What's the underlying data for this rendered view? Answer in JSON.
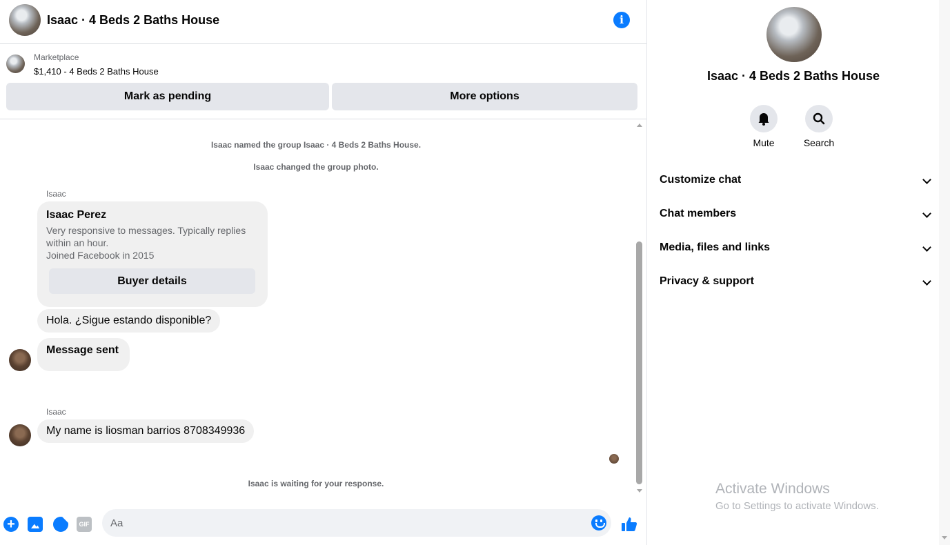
{
  "header": {
    "title": "Isaac · 4 Beds 2 Baths House"
  },
  "marketplace": {
    "label": "Marketplace",
    "item": "$1,410 - 4 Beds 2 Baths House",
    "mark_pending": "Mark as pending",
    "more_options": "More options"
  },
  "messages": {
    "sys_named": "Isaac named the group Isaac · 4 Beds 2 Baths House.",
    "sys_photo": "Isaac changed the group photo.",
    "sender1": "Isaac",
    "card": {
      "name": "Isaac Perez",
      "line1": "Very responsive to messages. Typically replies",
      "line2": "within an hour.",
      "line3": "Joined Facebook in 2015",
      "button": "Buyer details"
    },
    "msg1": "Hola. ¿Sigue estando disponible?",
    "msg2": "Message sent",
    "sender2": "Isaac",
    "msg3": "My name is liosman barrios 8708349936",
    "waiting": "Isaac is waiting for your response."
  },
  "composer": {
    "placeholder": "Aa",
    "gif": "GIF"
  },
  "info_panel": {
    "title": "Isaac · 4 Beds 2 Baths House",
    "mute": "Mute",
    "search": "Search",
    "sections": [
      "Customize chat",
      "Chat members",
      "Media, files and links",
      "Privacy & support"
    ]
  },
  "watermark": {
    "line1": "Activate Windows",
    "line2": "Go to Settings to activate Windows."
  },
  "colors": {
    "accent": "#0a7cff",
    "bubble": "#f0f0f0",
    "button": "#e4e6eb",
    "muted_text": "#65676b"
  }
}
